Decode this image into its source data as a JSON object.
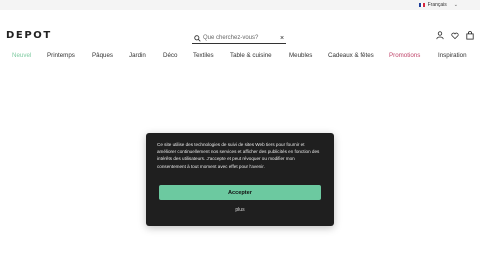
{
  "topbar": {
    "language": "Français",
    "flag_colors": [
      "#1f3f99",
      "#ffffff",
      "#d7263d"
    ]
  },
  "header": {
    "logo": "DEPOT",
    "search": {
      "placeholder": "Que cherchez-vous?",
      "clear": "×"
    },
    "icons": [
      "account-icon",
      "wishlist-icon",
      "cart-icon"
    ]
  },
  "nav": {
    "items": [
      "Neuvel",
      "Printemps",
      "Pâques",
      "Jardin",
      "Déco",
      "Textiles",
      "Table & cuisine",
      "Meubles",
      "Cadeaux & fêtes",
      "Promotions",
      "Inspiration"
    ],
    "highlight_new_color": "#7ecba1",
    "highlight_promo_color": "#c0456b"
  },
  "cookie_modal": {
    "message": "Ce site utilise des technologies de suivi de sites Web tiers pour fournir et améliorer continuellement nos services et afficher des publicités en fonction des intérêts des utilisateurs. J'accepte et peut révoquer ou modifier mon consentement à tout moment avec effet pour l'avenir.",
    "accept_label": "Accepter",
    "more_label": "plus",
    "background": "#1f1f1f",
    "accent": "#6cc9a0"
  }
}
